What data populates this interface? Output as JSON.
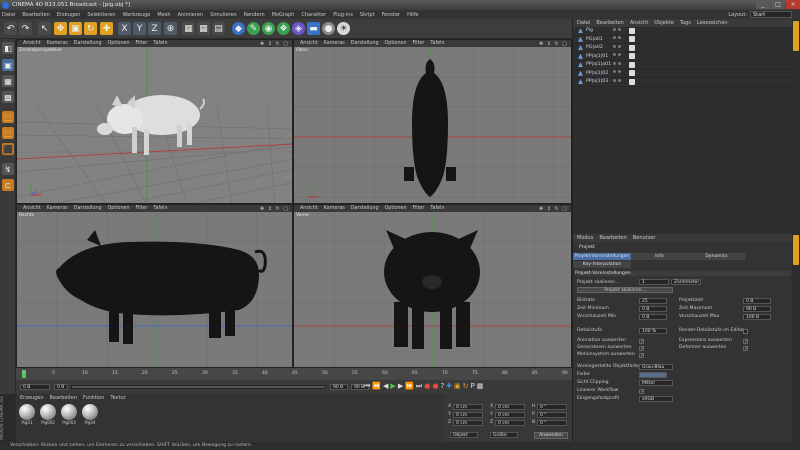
{
  "window": {
    "title": "CINEMA 4D R13.051 Broadcast - [pig.obj *]",
    "buttons": [
      "_",
      "□",
      "×"
    ]
  },
  "menubar": [
    "Datei",
    "Bearbeiten",
    "Erzeugen",
    "Selektieren",
    "Werkzeuge",
    "Mesh",
    "Animieren",
    "Simulieren",
    "Rendern",
    "MoGraph",
    "Charakter",
    "Plug-ins",
    "Skript",
    "Fenster",
    "Hilfe"
  ],
  "layout": {
    "label": "Layout:",
    "value": "Start"
  },
  "viewport_menu": [
    "Ansicht",
    "Kameras",
    "Darstellung",
    "Optionen",
    "Filter",
    "Tafeln"
  ],
  "viewports": [
    {
      "name": "Zentralperspektive"
    },
    {
      "name": "Oben"
    },
    {
      "name": "Rechts"
    },
    {
      "name": "Vorne"
    }
  ],
  "timeline": {
    "ticks": [
      "0",
      "5",
      "10",
      "15",
      "20",
      "25",
      "30",
      "35",
      "40",
      "45",
      "50",
      "55",
      "60",
      "65",
      "70",
      "75",
      "80",
      "85",
      "90"
    ],
    "current": "0 B",
    "start": "0 B",
    "end": "90 B",
    "end2": "90 B"
  },
  "materials": {
    "menu": [
      "Erzeugen",
      "Bearbeiten",
      "Funktion",
      "Textur"
    ],
    "items": [
      "Pig01",
      "Pig002",
      "Pig003",
      "Pig04"
    ]
  },
  "coords": {
    "rows": [
      [
        "X",
        "0 cm",
        "X",
        "0 cm",
        "H",
        "0 °"
      ],
      [
        "Y",
        "0 cm",
        "Y",
        "0 cm",
        "P",
        "0 °"
      ],
      [
        "Z",
        "0 cm",
        "Z",
        "0 cm",
        "B",
        "0 °"
      ]
    ],
    "mode1": "Objekt",
    "mode2": "Größe",
    "apply": "Anwenden"
  },
  "objects": {
    "menu": [
      "Datei",
      "Bearbeiten",
      "Ansicht",
      "Objekte",
      "Tags",
      "Lesezeichen"
    ],
    "items": [
      "Pig",
      "PG|a01",
      "PG|a02",
      "PP|a|1|01",
      "PP|a|1|a01",
      "PP|a|1|02",
      "PP|a|1|03"
    ]
  },
  "attributes": {
    "menu": [
      "Modus",
      "Bearbeiten",
      "Benutzer"
    ],
    "title": "Projekt",
    "tabs": [
      "Projekt-Voreinstellungen",
      "Info",
      "Dynamics",
      "Key-Interpolation"
    ],
    "section": "Projekt-Voreinstellungen",
    "project_scale_label": "Projekt skalieren ...",
    "project_scale": "1",
    "project_scale_unit": "Zentimeter",
    "scale_button": "Projekt skalieren...",
    "left": [
      {
        "label": "Bildrate",
        "value": "25"
      },
      {
        "label": "Zeit Minimum",
        "value": "0 B"
      },
      {
        "label": "Vorschauzeit Min",
        "value": "0 B"
      },
      {
        "label": "Detailstufe",
        "value": "100 %"
      }
    ],
    "right": [
      {
        "label": "Projektzeit",
        "value": "0 B"
      },
      {
        "label": "Zeit Maximum",
        "value": "90 B"
      },
      {
        "label": "Vorschauzeit Max",
        "value": "100 B"
      },
      {
        "label": "Render-Detailstufe im Editor",
        "value": ""
      }
    ],
    "checks_left": [
      "Animation auswerten",
      "Generatoren auswerten",
      "Motionsystem auswerten"
    ],
    "checks_right": [
      "Expressions auswerten",
      "Deformer auswerten"
    ],
    "bottom": [
      {
        "label": "Voreingestellte Objektfarbe",
        "value": "Grau-Blau"
      },
      {
        "label": "Farbe",
        "value": ""
      },
      {
        "label": "Sicht Clipping",
        "value": "Mittel"
      },
      {
        "label": "Linearer Workflow",
        "value": "✓"
      },
      {
        "label": "Eingangsfarbprofil",
        "value": "sRGB"
      }
    ]
  },
  "status": "Verschieben: Klicken und ziehen, um Elemente zu verschieben. SHIFT drücken, um Bewegung zu rastern.",
  "brand": "MAXON CINEMA 4D"
}
